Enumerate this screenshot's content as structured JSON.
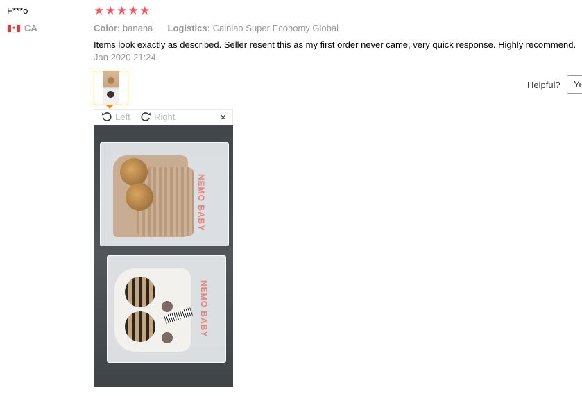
{
  "review": {
    "username": "F***o",
    "country_code": "CA",
    "rating": 5,
    "star_char": "★",
    "color_label": "Color:",
    "color_value": "banana",
    "logistics_label": "Logistics:",
    "logistics_value": "Cainiao Super Economy Global",
    "text": "Items look exactly as described. Seller resent this as my first order never came, very quick response. Highly recommend.",
    "date": "Jan 2020 21:24"
  },
  "feedback": {
    "helpful_label": "Helpful?",
    "yes_label": "Yes"
  },
  "viewer": {
    "rotate_left_label": "Left",
    "rotate_right_label": "Right",
    "close_glyph": "×"
  },
  "photo_text": {
    "bag_brand": "NEMO BABY"
  },
  "colors": {
    "star": "#f2555a",
    "thumb_border": "#f08a1d",
    "muted_text": "#999999"
  }
}
